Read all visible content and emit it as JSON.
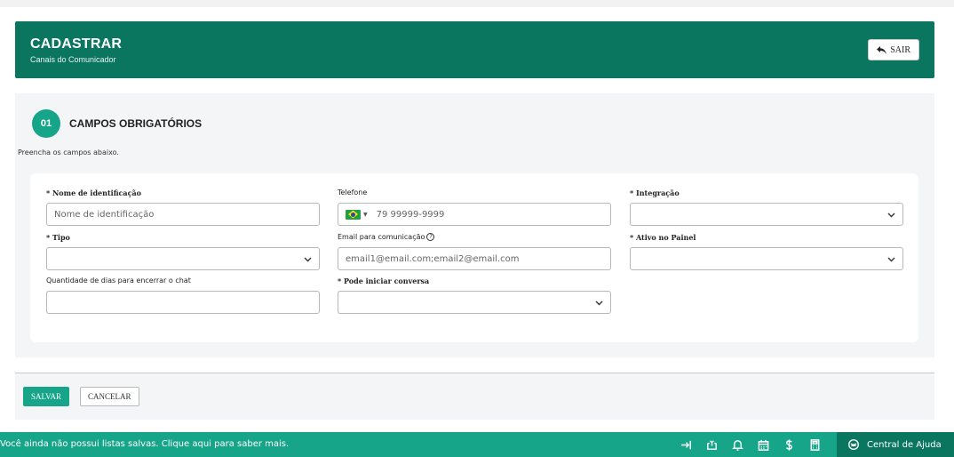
{
  "header": {
    "title": "CADASTRAR",
    "subtitle": "Canais do Comunicador",
    "exit_label": "SAIR"
  },
  "section": {
    "step_number": "01",
    "title": "CAMPOS OBRIGATÓRIOS",
    "description": "Preencha os campos abaixo."
  },
  "form": {
    "nome": {
      "label": "* Nome de identificação",
      "placeholder": "Nome de identificação",
      "value": ""
    },
    "telefone": {
      "label": "Telefone",
      "placeholder": "79 99999-9999",
      "value": "",
      "flag_icon": "brazil-flag-icon"
    },
    "integracao": {
      "label": "* Integração",
      "value": ""
    },
    "tipo": {
      "label": "* Tipo",
      "value": ""
    },
    "email": {
      "label": "Email para comunicação",
      "placeholder": "email1@email.com;email2@email.com",
      "value": "",
      "help_icon": "?"
    },
    "ativo": {
      "label": "* Ativo no Painel",
      "value": ""
    },
    "dias": {
      "label": "Quantidade de dias para encerrar o chat",
      "value": ""
    },
    "pode_iniciar": {
      "label": "* Pode iniciar conversa",
      "value": ""
    }
  },
  "actions": {
    "save_label": "SALVAR",
    "cancel_label": "CANCELAR"
  },
  "bottom_bar": {
    "message": "Você ainda não possui listas salvas. Clique aqui para saber mais.",
    "help_center_label": "Central de Ajuda",
    "icons": [
      "collapse-icon",
      "saved-list-icon",
      "bell-icon",
      "calendar-icon",
      "dollar-icon",
      "calculator-icon",
      "help-chat-icon"
    ]
  },
  "colors": {
    "header_bg": "#0b7660",
    "accent": "#17a589",
    "section_bg": "#f4f5f7"
  }
}
